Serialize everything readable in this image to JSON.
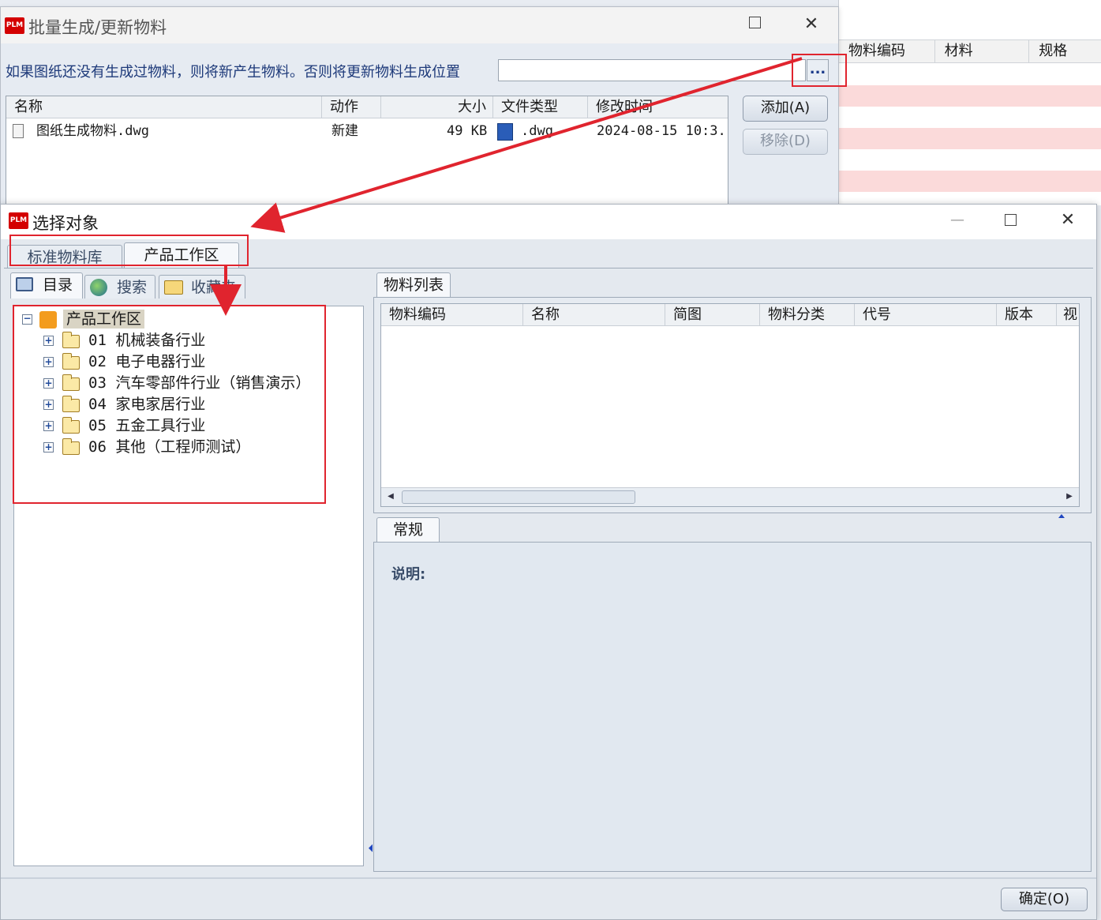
{
  "background_grid": {
    "columns": [
      "物料编码",
      "材料",
      "规格"
    ]
  },
  "dialog1": {
    "app_icon": "PLM",
    "title": "批量生成/更新物料",
    "info_text": "如果图纸还没有生成过物料，则将新产生物料。否则将更新物料",
    "location_label": "生成位置",
    "location_value": "",
    "browse_label": "...",
    "columns": [
      "名称",
      "动作",
      "大小",
      "文件类型",
      "修改时间"
    ],
    "rows": [
      {
        "name": "图纸生成物料.dwg",
        "action": "新建",
        "size": "49 KB",
        "type": ".dwg",
        "modified": "2024-08-15 10:3."
      }
    ],
    "add_button": "添加(A)",
    "remove_button": "移除(D)"
  },
  "dialog2": {
    "app_icon": "PLM",
    "title": "选择对象",
    "tabs": [
      "标准物料库",
      "产品工作区"
    ],
    "subtabs": [
      "目录",
      "搜索",
      "收藏夹"
    ],
    "tree": {
      "root": "产品工作区",
      "items": [
        "01 机械装备行业",
        "02 电子电器行业",
        "03 汽车零部件行业（销售演示）",
        "04 家电家居行业",
        "05 五金工具行业",
        "06 其他（工程师测试）"
      ]
    },
    "list_tab": "物料列表",
    "list_columns": [
      "物料编码",
      "名称",
      "简图",
      "物料分类",
      "代号",
      "版本",
      "视"
    ],
    "detail_tab": "常规",
    "description_label": "说明:",
    "ok_button": "确定(O)"
  },
  "colors": {
    "annotation_red": "#e0242e",
    "plm_red": "#d40000",
    "row_pink": "#fbdada"
  }
}
